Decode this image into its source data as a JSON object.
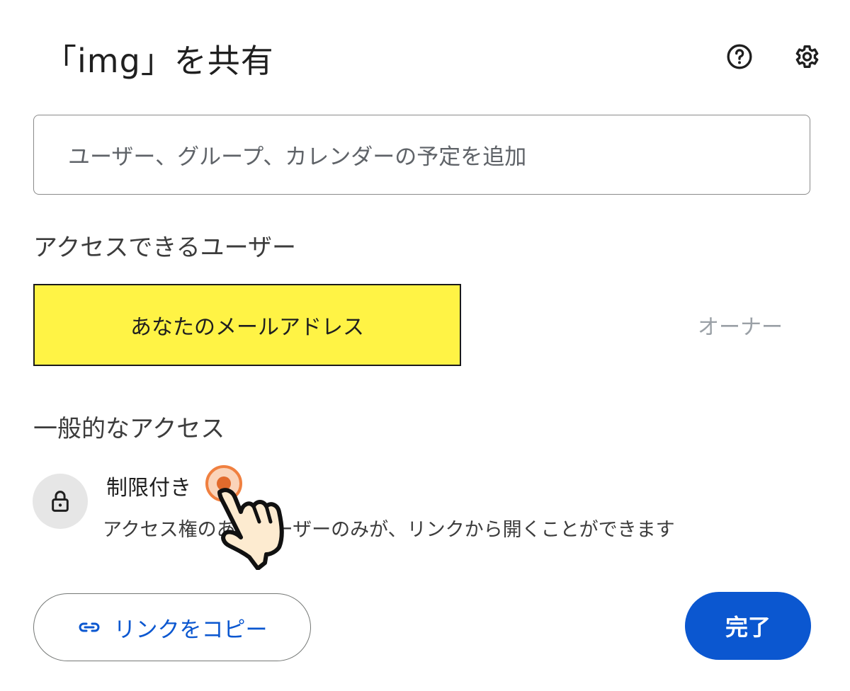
{
  "dialog": {
    "title": "「img」を共有",
    "help_icon": "help-circle-icon",
    "settings_icon": "gear-icon"
  },
  "add_people": {
    "placeholder": "ユーザー、グループ、カレンダーの予定を追加"
  },
  "people_with_access": {
    "heading": "アクセスできるユーザー",
    "users": [
      {
        "email_note": "あなたのメールアドレス",
        "role": "オーナー"
      }
    ]
  },
  "general_access": {
    "heading": "一般的なアクセス",
    "icon": "lock-icon",
    "mode": "制限付き",
    "description": "アクセス権のあるユーザーのみが、リンクから開くことができます"
  },
  "footer": {
    "copy_link_label": "リンクをコピー",
    "copy_link_icon": "link-icon",
    "done_label": "完了"
  },
  "colors": {
    "accent": "#0b57d0",
    "highlight_box": "#fff345",
    "click_marker": "#f08040"
  }
}
